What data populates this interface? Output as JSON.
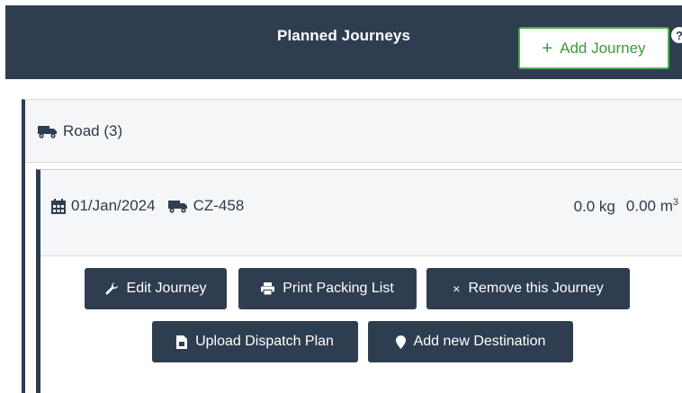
{
  "header": {
    "title": "Planned Journeys",
    "add_button_label": "Add Journey",
    "add_button_icon": "plus-icon",
    "help_icon": "?"
  },
  "mode_group": {
    "icon": "truck-icon",
    "label": "Road (3)"
  },
  "journey": {
    "date": "01/Jan/2024",
    "vehicle": "CZ-458",
    "weight": "0.0 kg",
    "volume": "0.00 m",
    "volume_exp": "3"
  },
  "actions": {
    "edit_journey": "Edit Journey",
    "print_packing_list": "Print Packing List",
    "remove_journey": "Remove this Journey",
    "upload_dispatch_plan": "Upload Dispatch Plan",
    "add_destination": "Add new Destination"
  },
  "colors": {
    "header_bg": "#2f3d50",
    "button_bg": "#2f3d50",
    "accent_green": "#4caf50"
  }
}
